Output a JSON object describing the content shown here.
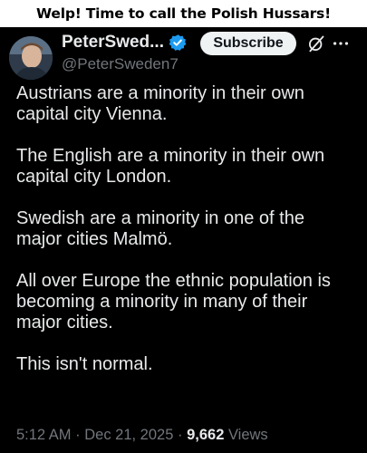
{
  "caption": "Welp! Time to call the Polish Hussars!",
  "post": {
    "author": {
      "display_name": "PeterSwed...",
      "handle": "@PeterSweden7",
      "verified": true,
      "verified_color": "#1d9bf0"
    },
    "subscribe_label": "Subscribe",
    "icons": {
      "grok": "grok-icon",
      "more": "more-icon"
    },
    "paragraphs": [
      "Austrians are a minority in their own\ncapital city Vienna.",
      "The English are a minority in their own\ncapital city London.",
      "Swedish are a minority in one of the\nmajor cities Malmö.",
      "All over Europe the ethnic population is\nbecoming a minority in many of their\nmajor cities.",
      "This isn't normal."
    ],
    "time": "5:12 AM",
    "separator": "·",
    "date": "Dec 21, 2025",
    "views_count": "9,662",
    "views_label": "Views"
  },
  "colors": {
    "background": "#000000",
    "text": "#e7e9ea",
    "secondary": "#71767b",
    "accent": "#1d9bf0"
  }
}
